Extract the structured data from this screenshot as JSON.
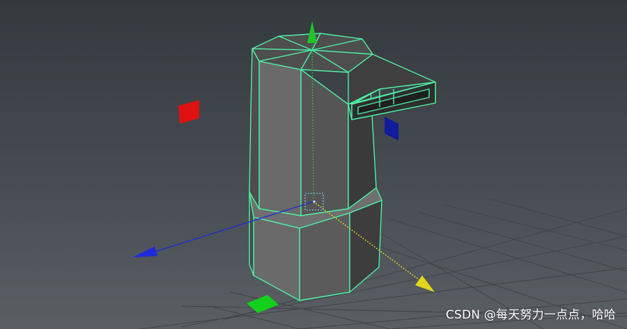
{
  "viewport": {
    "background_top": "#34393e",
    "background_bottom": "#5a5f64",
    "grid_color": "#3f4448",
    "wire_color": "#4ef0a6",
    "face_color": "#5d5d5d"
  },
  "manipulator": {
    "x_axis_color": "#1f2ad6",
    "y_axis_color": "#22c22a",
    "z_axis_color": "#e2d61c",
    "plane_handles": {
      "red": "#e01111",
      "blue": "#101c9c",
      "green": "#12d01c"
    }
  },
  "watermark": {
    "text": "CSDN @每天努力一点点，哈哈"
  }
}
